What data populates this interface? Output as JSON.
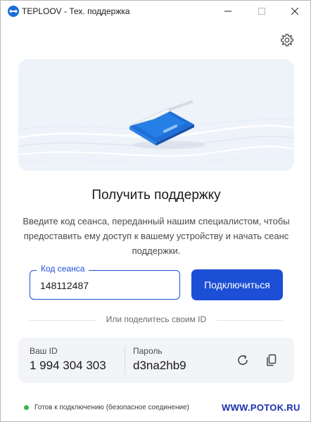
{
  "window": {
    "title": "TEPLOOV - Тех. поддержка",
    "logo_icon": "teamviewer-arrows-icon",
    "accent": "#1d4fd6"
  },
  "main": {
    "heading": "Получить поддержку",
    "description": "Введите код сеанса, переданный нашим специалистом, чтобы предоставить ему доступ к вашему устройству и начать сеанс поддержки.",
    "session_field": {
      "label": "Код сеанса",
      "value": "148112487"
    },
    "connect_label": "Подключиться",
    "divider_text": "Или поделитесь своим ID"
  },
  "id_card": {
    "id_label": "Ваш ID",
    "id_value": "1 994 304 303",
    "password_label": "Пароль",
    "password_value": "d3na2hb9"
  },
  "status": {
    "text": "Готов к подключению (безопасное соединение)",
    "color": "#3cb44b"
  },
  "watermark": "WWW.POTOK.RU"
}
